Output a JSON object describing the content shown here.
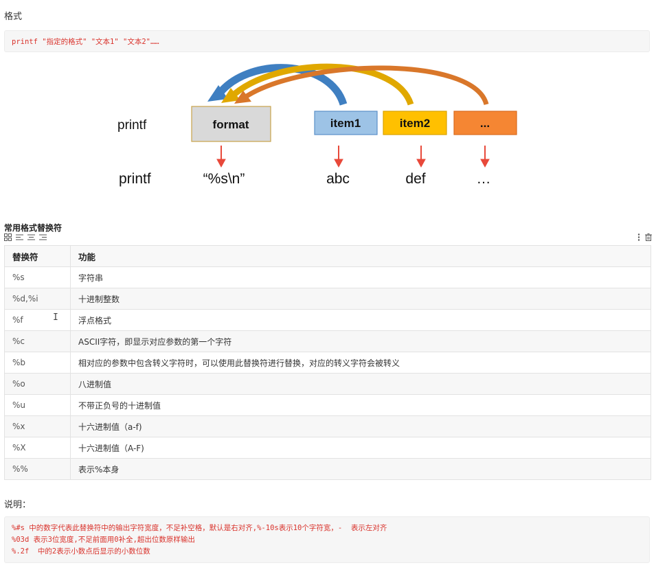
{
  "section1": {
    "heading": "格式"
  },
  "format_code": "printf \"指定的格式\" \"文本1\" \"文本2\"……",
  "diagram": {
    "row1_label": "printf",
    "boxes": [
      {
        "label": "format",
        "fill": "#d9d9d9",
        "stroke": "#c9a34a"
      },
      {
        "label": "item1",
        "fill": "#9dc3e6",
        "stroke": "#5b8fc7"
      },
      {
        "label": "item2",
        "fill": "#ffc000",
        "stroke": "#d9a300"
      },
      {
        "label": "...",
        "fill": "#f58633",
        "stroke": "#d96b1e"
      }
    ],
    "row2_label": "printf",
    "row2_values": [
      "“%s\\n”",
      "abc",
      "def",
      "…"
    ],
    "colors": {
      "arrow_blue": "#3f7fc1",
      "arrow_gold": "#e0a800",
      "arrow_orange": "#d9772a",
      "down_arrow": "#e8493a"
    }
  },
  "table_section": {
    "heading": "常用格式替换符",
    "toolbar_icons": [
      "grid-icon",
      "align-left-icon",
      "align-center-icon",
      "align-right-icon"
    ],
    "toolbar_right_icons": [
      "more-vertical-icon",
      "delete-icon"
    ]
  },
  "table": {
    "headers": [
      "替换符",
      "功能"
    ],
    "rows": [
      [
        "%s",
        "字符串"
      ],
      [
        "%d,%i",
        "十进制整数"
      ],
      [
        "%f",
        "浮点格式"
      ],
      [
        "%c",
        "ASCII字符，即显示对应参数的第一个字符"
      ],
      [
        "%b",
        "相对应的参数中包含转义字符时，可以使用此替换符进行替换，对应的转义字符会被转义"
      ],
      [
        "%o",
        "八进制值"
      ],
      [
        "%u",
        "不带正负号的十进制值"
      ],
      [
        "%x",
        "十六进制值（a-f)"
      ],
      [
        "%X",
        "十六进制值（A-F)"
      ],
      [
        "%%",
        "表示%本身"
      ]
    ]
  },
  "section3": {
    "heading": "说明："
  },
  "notes_code": [
    "%#s 中的数字代表此替换符中的输出字符宽度，不足补空格，默认是右对齐,%-10s表示10个字符宽，-  表示左对齐",
    "%03d 表示3位宽度,不足前面用0补全,超出位数原样输出",
    "%.2f  中的2表示小数点后显示的小数位数"
  ]
}
